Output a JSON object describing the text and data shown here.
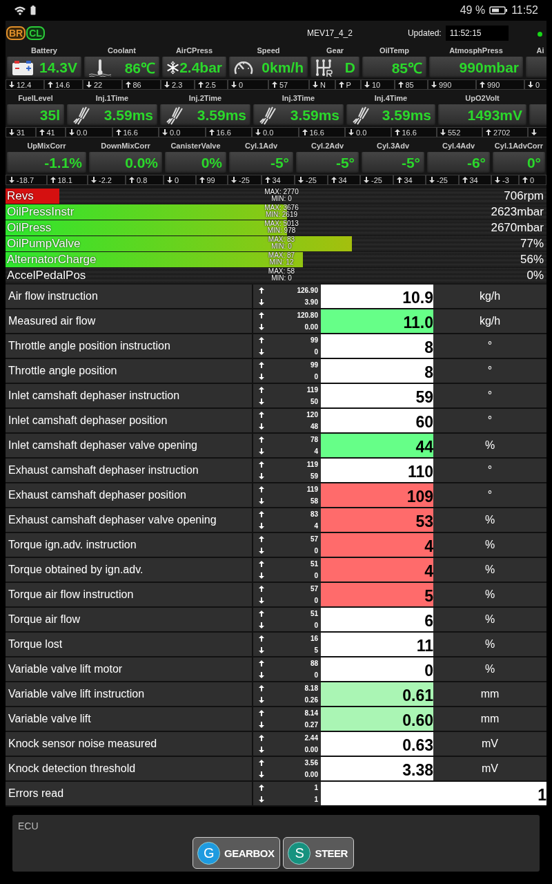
{
  "status_bar": {
    "battery": "49 %",
    "time": "11:52"
  },
  "header": {
    "badges": [
      {
        "text": "BR",
        "color": "#e0902a"
      },
      {
        "text": "CL",
        "color": "#2ccc3a"
      }
    ],
    "ecu": "MEV17_4_2",
    "updated_label": "Updated:",
    "updated_time": "11:52:15",
    "connected": true
  },
  "gauge_rows": [
    [
      {
        "label": "Battery",
        "value": "14.3V",
        "min": "12.4",
        "max": "14.6"
      },
      {
        "label": "Coolant",
        "value": "86℃",
        "min": "22",
        "max": "86"
      },
      {
        "label": "AirCPress",
        "value": "2.4bar",
        "min": "2.3",
        "max": "2.5"
      },
      {
        "label": "Speed",
        "value": "0km/h",
        "min": "0",
        "max": "57"
      },
      {
        "label": "Gear",
        "value": "D",
        "min": "N",
        "max": "P"
      },
      {
        "label": "OilTemp",
        "value": "85℃",
        "min": "10",
        "max": "85"
      },
      {
        "label": "AtmosphPress",
        "value": "990mbar",
        "min": "990",
        "max": "990"
      },
      {
        "label": "Ai",
        "min": "0"
      }
    ],
    [
      {
        "label": "FuelLevel",
        "value": "35l",
        "min": "31",
        "max": "41"
      },
      {
        "label": "Inj.1Time",
        "value": "3.59ms",
        "min": "0.0",
        "max": "16.6"
      },
      {
        "label": "Inj.2Time",
        "value": "3.59ms",
        "min": "0.0",
        "max": "16.6"
      },
      {
        "label": "Inj.3Time",
        "value": "3.59ms",
        "min": "0.0",
        "max": "16.6"
      },
      {
        "label": "Inj.4Time",
        "value": "3.59ms",
        "min": "0.0",
        "max": "16.6"
      },
      {
        "label": "UpO2Volt",
        "value": "1493mV",
        "min": "552",
        "max": "2702"
      },
      {}
    ],
    [
      {
        "label": "UpMixCorr",
        "value": "-1.1%",
        "min": "-18.7",
        "max": "18.1"
      },
      {
        "label": "DownMixCorr",
        "value": "0.0%",
        "min": "-2.2",
        "max": "0.8"
      },
      {
        "label": "CanisterValve",
        "value": "0%",
        "min": "0",
        "max": "99"
      },
      {
        "label": "Cyl.1Adv",
        "value": "-5°",
        "min": "-25",
        "max": "34"
      },
      {
        "label": "Cyl.2Adv",
        "value": "-5°",
        "min": "-25",
        "max": "34"
      },
      {
        "label": "Cyl.3Adv",
        "value": "-5°",
        "min": "-25",
        "max": "34"
      },
      {
        "label": "Cyl.4Adv",
        "value": "-6°",
        "min": "-25",
        "max": "34"
      },
      {
        "label": "Cyl.1AdvCorr",
        "value": "0°",
        "min": "-3",
        "max": "0"
      }
    ]
  ],
  "bars": [
    {
      "label": "Revs",
      "kind": "alarm",
      "level": 0.1,
      "max": "MAX: 2770",
      "min": "MIN: 0",
      "value": "706rpm"
    },
    {
      "label": "OilPressInstr",
      "kind": "normal",
      "level": 0.52,
      "max": "MAX: 3676",
      "min": "MIN: 2619",
      "value": "2623mbar"
    },
    {
      "label": "OilPress",
      "kind": "normal",
      "level": 0.52,
      "max": "MAX: 5013",
      "min": "MIN: 978",
      "value": "2670mbar"
    },
    {
      "label": "OilPumpValve",
      "kind": "normal",
      "level": 0.64,
      "max": "MAX: 83",
      "min": "MIN: 0",
      "value": "77%"
    },
    {
      "label": "AlternatorCharge",
      "kind": "normal",
      "level": 0.55,
      "max": "MAX: 87",
      "min": "MIN: 12",
      "value": "56%"
    },
    {
      "label": "AccelPedalPos",
      "kind": "normal",
      "level": 0,
      "max": "MAX: 58",
      "min": "MIN: 0",
      "value": "0%"
    }
  ],
  "rows": [
    {
      "name": "Air flow instruction",
      "max": "126.90",
      "min": "3.90",
      "value": "10.9",
      "unit": "kg/h",
      "color": "#ffffff"
    },
    {
      "name": "Measured air flow",
      "max": "120.80",
      "min": "0.00",
      "value": "11.0",
      "unit": "kg/h",
      "color": "#66ff88"
    },
    {
      "name": "Throttle angle position instruction",
      "max": "99",
      "min": "0",
      "value": "8",
      "unit": "°",
      "color": "#ffffff"
    },
    {
      "name": "Throttle angle position",
      "max": "99",
      "min": "0",
      "value": "8",
      "unit": "°",
      "color": "#ffffff"
    },
    {
      "name": "Inlet camshaft dephaser instruction",
      "max": "119",
      "min": "50",
      "value": "59",
      "unit": "°",
      "color": "#ffffff"
    },
    {
      "name": "Inlet camshaft dephaser position",
      "max": "120",
      "min": "48",
      "value": "60",
      "unit": "°",
      "color": "#ffffff"
    },
    {
      "name": "Inlet camshaft dephaser valve opening",
      "max": "78",
      "min": "4",
      "value": "44",
      "unit": "%",
      "color": "#66ff88"
    },
    {
      "name": "Exhaust camshaft dephaser instruction",
      "max": "119",
      "min": "59",
      "value": "110",
      "unit": "°",
      "color": "#ffffff"
    },
    {
      "name": "Exhaust camshaft dephaser position",
      "max": "119",
      "min": "58",
      "value": "109",
      "unit": "°",
      "color": "#ff6b6b"
    },
    {
      "name": "Exhaust camshaft dephaser valve opening",
      "max": "83",
      "min": "4",
      "value": "53",
      "unit": "%",
      "color": "#ff6b6b"
    },
    {
      "name": "Torque ign.adv. instruction",
      "max": "57",
      "min": "0",
      "value": "4",
      "unit": "%",
      "color": "#ff6b6b"
    },
    {
      "name": "Torque obtained by ign.adv.",
      "max": "51",
      "min": "0",
      "value": "4",
      "unit": "%",
      "color": "#ff6b6b"
    },
    {
      "name": "Torque air flow instruction",
      "max": "57",
      "min": "0",
      "value": "5",
      "unit": "%",
      "color": "#ff6b6b"
    },
    {
      "name": "Torque air flow",
      "max": "51",
      "min": "0",
      "value": "6",
      "unit": "%",
      "color": "#ffffff"
    },
    {
      "name": "Torque lost",
      "max": "16",
      "min": "5",
      "value": "11",
      "unit": "%",
      "color": "#ffffff"
    },
    {
      "name": "Variable valve lift motor",
      "max": "88",
      "min": "0",
      "value": "0",
      "unit": "%",
      "color": "#ffffff"
    },
    {
      "name": "Variable valve lift instruction",
      "max": "8.18",
      "min": "0.26",
      "value": "0.61",
      "unit": "mm",
      "color": "#aaf5b4"
    },
    {
      "name": "Variable valve lift",
      "max": "8.14",
      "min": "0.27",
      "value": "0.60",
      "unit": "mm",
      "color": "#aaf5b4"
    },
    {
      "name": "Knock sensor noise measured",
      "max": "2.44",
      "min": "0.00",
      "value": "0.63",
      "unit": "mV",
      "color": "#ffffff"
    },
    {
      "name": "Knock detection threshold",
      "max": "3.56",
      "min": "0.00",
      "value": "3.38",
      "unit": "mV",
      "color": "#ffffff"
    },
    {
      "name": "Errors read",
      "max": "1",
      "min": "1",
      "value": "1",
      "color": "#ffffff"
    }
  ],
  "panel": {
    "title": "ECU",
    "buttons": [
      {
        "letter": "G",
        "label": "GEARBOX",
        "color": "#1e9be0"
      },
      {
        "letter": "S",
        "label": "STEER",
        "color": "#16927f"
      }
    ]
  }
}
